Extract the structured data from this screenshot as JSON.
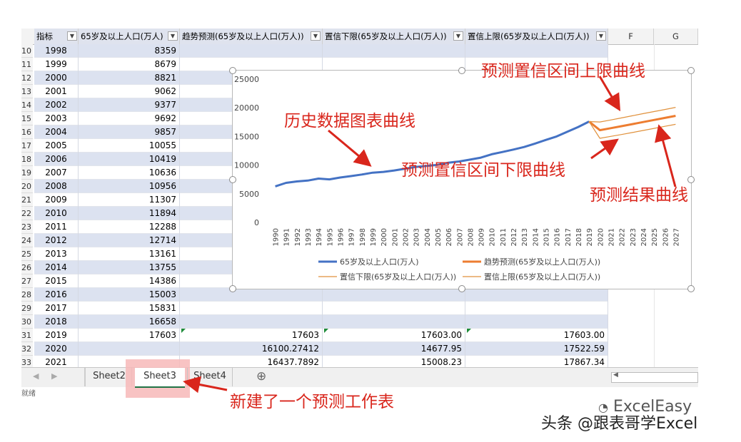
{
  "headers": {
    "col_indicator": "指标",
    "col_pop": "65岁及以上人口(万人)",
    "col_trend": "趋势预测(65岁及以上人口(万人))",
    "col_lower": "置信下限(65岁及以上人口(万人))",
    "col_upper": "置信上限(65岁及以上人口(万人))",
    "col_f": "F",
    "col_g": "G",
    "dropdown_glyph": "▼"
  },
  "rows": [
    {
      "num": "10",
      "year": "1998",
      "pop": "8359",
      "trend": "",
      "lo": "",
      "hi": ""
    },
    {
      "num": "11",
      "year": "1999",
      "pop": "8679",
      "trend": "",
      "lo": "",
      "hi": ""
    },
    {
      "num": "12",
      "year": "2000",
      "pop": "8821",
      "trend": "",
      "lo": "",
      "hi": ""
    },
    {
      "num": "13",
      "year": "2001",
      "pop": "9062",
      "trend": "",
      "lo": "",
      "hi": ""
    },
    {
      "num": "14",
      "year": "2002",
      "pop": "9377",
      "trend": "",
      "lo": "",
      "hi": ""
    },
    {
      "num": "15",
      "year": "2003",
      "pop": "9692",
      "trend": "",
      "lo": "",
      "hi": ""
    },
    {
      "num": "16",
      "year": "2004",
      "pop": "9857",
      "trend": "",
      "lo": "",
      "hi": ""
    },
    {
      "num": "17",
      "year": "2005",
      "pop": "10055",
      "trend": "",
      "lo": "",
      "hi": ""
    },
    {
      "num": "18",
      "year": "2006",
      "pop": "10419",
      "trend": "",
      "lo": "",
      "hi": ""
    },
    {
      "num": "19",
      "year": "2007",
      "pop": "10636",
      "trend": "",
      "lo": "",
      "hi": ""
    },
    {
      "num": "20",
      "year": "2008",
      "pop": "10956",
      "trend": "",
      "lo": "",
      "hi": ""
    },
    {
      "num": "21",
      "year": "2009",
      "pop": "11307",
      "trend": "",
      "lo": "",
      "hi": ""
    },
    {
      "num": "22",
      "year": "2010",
      "pop": "11894",
      "trend": "",
      "lo": "",
      "hi": ""
    },
    {
      "num": "23",
      "year": "2011",
      "pop": "12288",
      "trend": "",
      "lo": "",
      "hi": ""
    },
    {
      "num": "24",
      "year": "2012",
      "pop": "12714",
      "trend": "",
      "lo": "",
      "hi": ""
    },
    {
      "num": "25",
      "year": "2013",
      "pop": "13161",
      "trend": "",
      "lo": "",
      "hi": ""
    },
    {
      "num": "26",
      "year": "2014",
      "pop": "13755",
      "trend": "",
      "lo": "",
      "hi": ""
    },
    {
      "num": "27",
      "year": "2015",
      "pop": "14386",
      "trend": "",
      "lo": "",
      "hi": ""
    },
    {
      "num": "28",
      "year": "2016",
      "pop": "15003",
      "trend": "",
      "lo": "",
      "hi": ""
    },
    {
      "num": "29",
      "year": "2017",
      "pop": "15831",
      "trend": "",
      "lo": "",
      "hi": ""
    },
    {
      "num": "30",
      "year": "2018",
      "pop": "16658",
      "trend": "",
      "lo": "",
      "hi": ""
    },
    {
      "num": "31",
      "year": "2019",
      "pop": "17603",
      "trend": "17603",
      "lo": "17603.00",
      "hi": "17603.00"
    },
    {
      "num": "32",
      "year": "2020",
      "pop": "",
      "trend": "16100.27412",
      "lo": "14677.95",
      "hi": "17522.59"
    },
    {
      "num": "33",
      "year": "2021",
      "pop": "",
      "trend": "16437.7892",
      "lo": "15008.23",
      "hi": "17867.34"
    }
  ],
  "tabs": [
    "Sheet2",
    "Sheet3",
    "Sheet4"
  ],
  "add_sheet_icon": "⊕",
  "status_text": "就绪",
  "annotations": {
    "history": "历史数据图表曲线",
    "upper": "预测置信区间上限曲线",
    "lower": "预测置信区间下限曲线",
    "forecast": "预测结果曲线",
    "new_sheet": "新建了一个预测工作表"
  },
  "watermark": {
    "brand": "ExcelEasy",
    "account": "头条 @跟表哥学Excel"
  },
  "colors": {
    "history_line": "#4472c4",
    "forecast_line": "#ed7d31",
    "bound_line": "#e0913c",
    "annotation": "#d9261c",
    "table_band": "#dce2f0",
    "tab_highlight": "#f7b9b9"
  },
  "chart_data": {
    "type": "line",
    "x": [
      "1990",
      "1991",
      "1992",
      "1993",
      "1994",
      "1995",
      "1996",
      "1997",
      "1998",
      "1999",
      "2000",
      "2001",
      "2002",
      "2003",
      "2004",
      "2005",
      "2006",
      "2007",
      "2008",
      "2009",
      "2010",
      "2011",
      "2012",
      "2013",
      "2014",
      "2015",
      "2016",
      "2017",
      "2018",
      "2019",
      "2020",
      "2021",
      "2022",
      "2023",
      "2024",
      "2025",
      "2026",
      "2027"
    ],
    "ylim": [
      0,
      25000
    ],
    "yticks": [
      "0",
      "5000",
      "10000",
      "15000",
      "20000",
      "25000"
    ],
    "series": [
      {
        "name": "65岁及以上人口(万人)",
        "values": [
          6299,
          6900,
          7150,
          7300,
          7650,
          7510,
          7830,
          8085,
          8359,
          8679,
          8821,
          9062,
          9377,
          9692,
          9857,
          10055,
          10419,
          10636,
          10956,
          11307,
          11894,
          12288,
          12714,
          13161,
          13755,
          14386,
          15003,
          15831,
          16658,
          17603,
          null,
          null,
          null,
          null,
          null,
          null,
          null,
          null
        ]
      },
      {
        "name": "趋势预测(65岁及以上人口(万人))",
        "values": [
          null,
          null,
          null,
          null,
          null,
          null,
          null,
          null,
          null,
          null,
          null,
          null,
          null,
          null,
          null,
          null,
          null,
          null,
          null,
          null,
          null,
          null,
          null,
          null,
          null,
          null,
          null,
          null,
          null,
          17603,
          16100,
          16438,
          16790,
          17150,
          17510,
          17870,
          18230,
          18600
        ]
      },
      {
        "name": "置信下限(65岁及以上人口(万人))",
        "values": [
          null,
          null,
          null,
          null,
          null,
          null,
          null,
          null,
          null,
          null,
          null,
          null,
          null,
          null,
          null,
          null,
          null,
          null,
          null,
          null,
          null,
          null,
          null,
          null,
          null,
          null,
          null,
          null,
          null,
          17603,
          14678,
          15008,
          15340,
          15690,
          16040,
          16400,
          16760,
          17120
        ]
      },
      {
        "name": "置信上限(65岁及以上人口(万人))",
        "values": [
          null,
          null,
          null,
          null,
          null,
          null,
          null,
          null,
          null,
          null,
          null,
          null,
          null,
          null,
          null,
          null,
          null,
          null,
          null,
          null,
          null,
          null,
          null,
          null,
          null,
          null,
          null,
          null,
          null,
          17603,
          17523,
          17867,
          18240,
          18610,
          18980,
          19340,
          19700,
          20070
        ]
      }
    ],
    "legend": "bottom",
    "grid": false
  }
}
